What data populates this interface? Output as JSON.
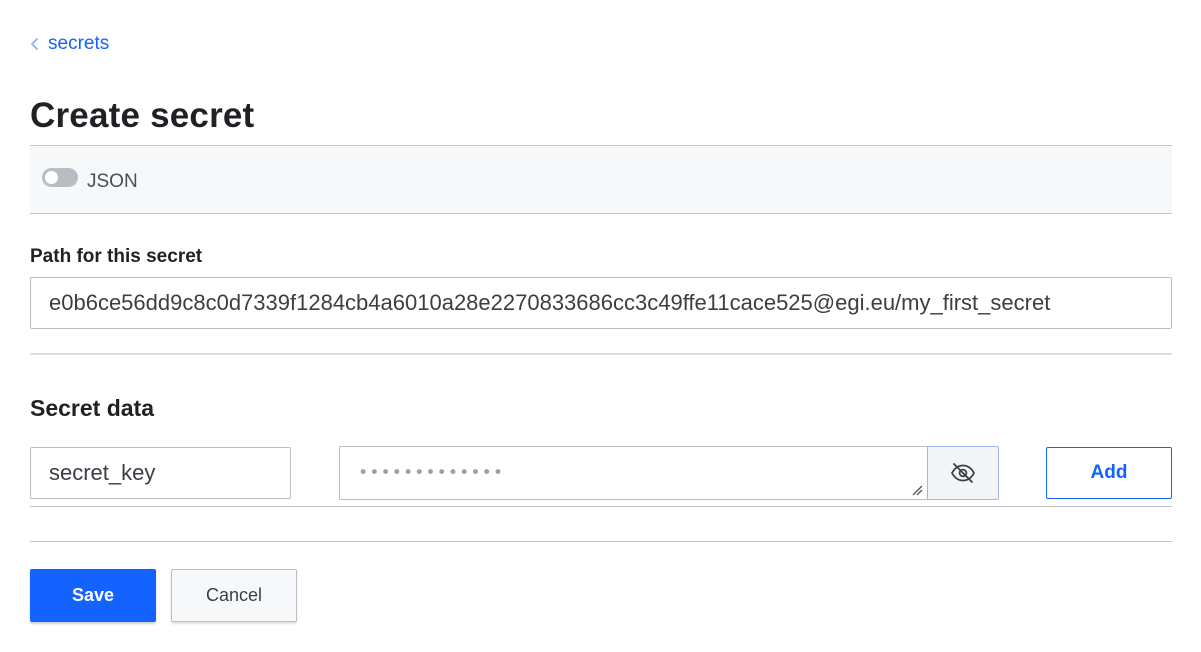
{
  "breadcrumb": {
    "label": "secrets",
    "icon": "chevron-left-icon"
  },
  "page": {
    "title": "Create secret"
  },
  "json_toggle": {
    "label": "JSON",
    "enabled": false
  },
  "path": {
    "label": "Path for this secret",
    "value": "e0b6ce56dd9c8c0d7339f1284cb4a6010a28e2270833686cc3c49ffe11cace525@egi.eu/my_first_secret"
  },
  "secret_data": {
    "title": "Secret data",
    "key_value": "secret_key",
    "masked_value": "•••••••••••••",
    "visibility_icon": "eye-off-icon",
    "add_label": "Add"
  },
  "actions": {
    "save_label": "Save",
    "cancel_label": "Cancel"
  },
  "colors": {
    "accent": "#1563ff",
    "text": "#1f2124",
    "border": "#babec5"
  }
}
